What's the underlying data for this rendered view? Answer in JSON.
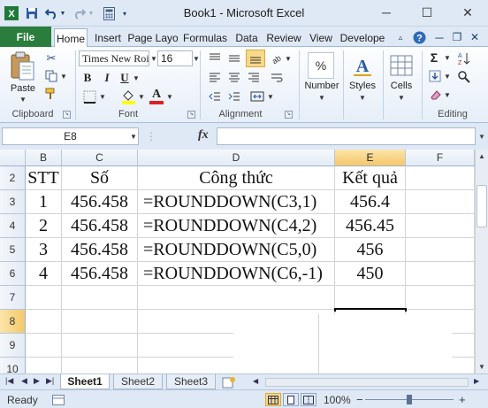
{
  "window": {
    "title": "Book1 - Microsoft Excel",
    "minimize_glyph": "─",
    "maximize_glyph": "☐",
    "close_glyph": "✕"
  },
  "quick_access": {
    "save_icon": "save-icon",
    "undo_icon": "undo-icon",
    "redo_icon": "redo-icon",
    "calc_icon": "calculator-icon"
  },
  "tabs": {
    "file": "File",
    "items": [
      "Home",
      "Insert",
      "Page Layo",
      "Formulas",
      "Data",
      "Review",
      "View",
      "Develope"
    ]
  },
  "ribbon": {
    "paste_label": "Paste",
    "clipboard_label": "Clipboard",
    "font_name": "Times New Roi",
    "font_size": "16",
    "bold": "B",
    "italic": "I",
    "underline": "U",
    "font_group_label": "Font",
    "alignment_label": "Alignment",
    "number_label": "Number",
    "number_icon": "%",
    "styles_label": "Styles",
    "cells_label": "Cells",
    "editing_label": "Editing",
    "sum_glyph": "Σ",
    "font_color_glyph": "A",
    "fill_color": "#ffff00",
    "font_color": "#e02020"
  },
  "formula_bar": {
    "name_box": "E8",
    "fx": "fx",
    "formula": ""
  },
  "grid": {
    "columns": [
      "B",
      "C",
      "D",
      "E",
      "F"
    ],
    "selected_column": "E",
    "rows": [
      "2",
      "3",
      "4",
      "5",
      "6",
      "7",
      "8",
      "9",
      "10"
    ],
    "selected_row": "8",
    "header": [
      "STT",
      "Số",
      "Công thức",
      "Kết quả"
    ],
    "data": [
      [
        "1",
        "456.458",
        "=ROUNDDOWN(C3,1)",
        "456.4"
      ],
      [
        "2",
        "456.458",
        "=ROUNDDOWN(C4,2)",
        "456.45"
      ],
      [
        "3",
        "456.458",
        "=ROUNDDOWN(C5,0)",
        "456"
      ],
      [
        "4",
        "456.458",
        "=ROUNDDOWN(C6,-1)",
        "450"
      ]
    ]
  },
  "sheets": {
    "tabs": [
      "Sheet1",
      "Sheet2",
      "Sheet3"
    ],
    "active": "Sheet1"
  },
  "status": {
    "text": "Ready",
    "zoom": "100%"
  }
}
